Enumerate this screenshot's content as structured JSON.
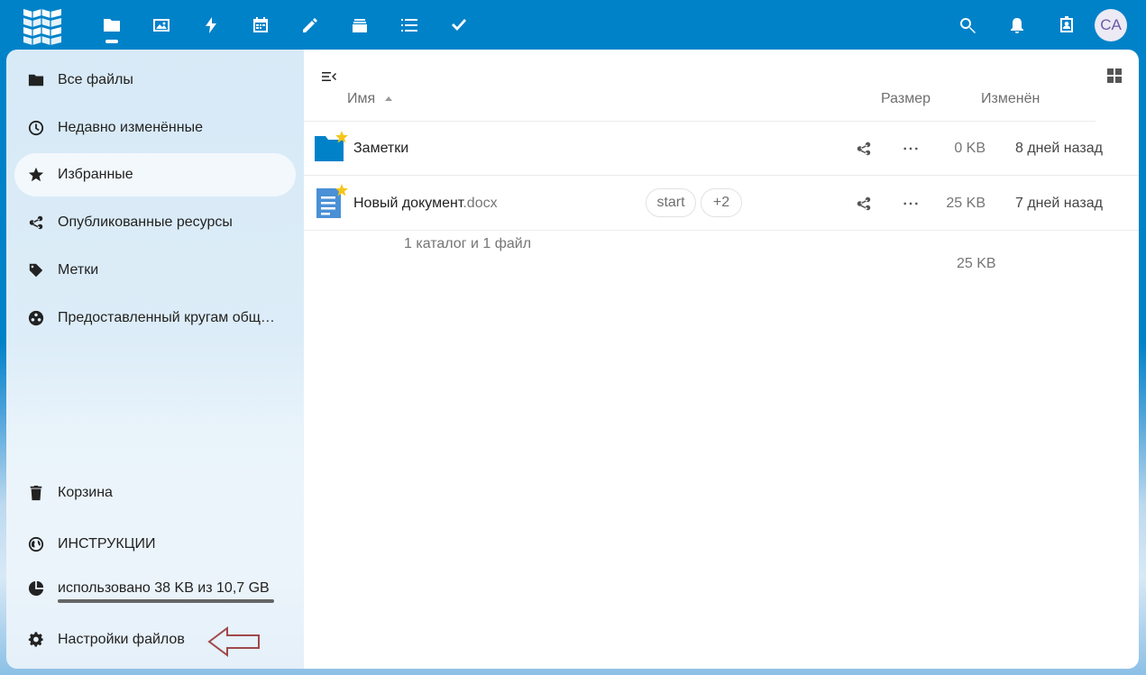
{
  "colors": {
    "primary": "#0082c9",
    "text": "#222222",
    "muted": "#757575",
    "star": "#f5c518"
  },
  "topbar": {
    "logo_icon": "cloud-logo-icon",
    "apps": [
      {
        "name": "files-app-icon",
        "active": true
      },
      {
        "name": "photos-app-icon",
        "active": false
      },
      {
        "name": "activity-app-icon",
        "active": false
      },
      {
        "name": "calendar-app-icon",
        "active": false
      },
      {
        "name": "notes-app-icon",
        "active": false
      },
      {
        "name": "deck-app-icon",
        "active": false
      },
      {
        "name": "tasks-app-icon",
        "active": false
      },
      {
        "name": "checkmark-app-icon",
        "active": false
      }
    ],
    "right_icons": [
      "search-icon",
      "bell-icon",
      "contacts-icon"
    ],
    "avatar_initials": "CA"
  },
  "sidebar": {
    "items": [
      {
        "label": "Все файлы",
        "icon": "folder-icon"
      },
      {
        "label": "Недавно изменённые",
        "icon": "clock-icon"
      },
      {
        "label": "Избранные",
        "icon": "star-icon",
        "active": true
      },
      {
        "label": "Опубликованные ресурсы",
        "icon": "share-icon"
      },
      {
        "label": "Метки",
        "icon": "tag-icon"
      },
      {
        "label": "Предоставленный кругам общ…",
        "icon": "circles-icon"
      }
    ],
    "bottom_items": [
      {
        "label": "Корзина",
        "icon": "trash-icon"
      },
      {
        "label": "ИНСТРУКЦИИ",
        "icon": "globe-icon"
      },
      {
        "label": "использовано 38 KB из 10,7 GB",
        "icon": "pie-icon"
      },
      {
        "label": "Настройки файлов",
        "icon": "gear-icon"
      }
    ]
  },
  "table": {
    "headers": {
      "name": "Имя",
      "size": "Размер",
      "modified": "Изменён"
    },
    "rows": [
      {
        "name": "Заметки",
        "ext": "",
        "type": "folder",
        "favorite": true,
        "size": "0 KB",
        "modified": "8 дней назад",
        "tags": []
      },
      {
        "name": "Новый документ",
        "ext": ".docx",
        "type": "document",
        "favorite": true,
        "size": "25 KB",
        "modified": "7 дней назад",
        "tags": [
          "start",
          "+2"
        ]
      }
    ],
    "summary_text": "1 каталог и 1 файл",
    "summary_size": "25 KB"
  }
}
